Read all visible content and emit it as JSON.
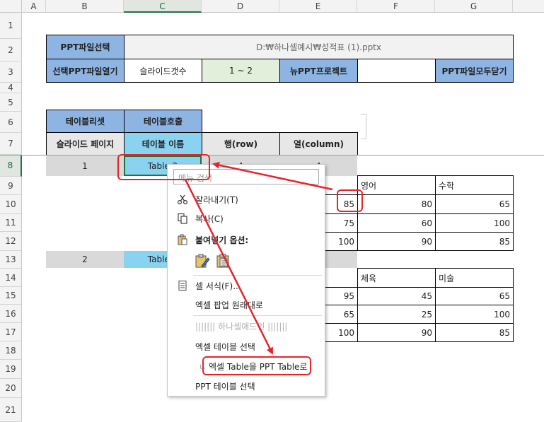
{
  "columns": [
    "A",
    "B",
    "C",
    "D",
    "E",
    "F",
    "G"
  ],
  "rows": [
    "1",
    "2",
    "3",
    "4",
    "5",
    "6",
    "7",
    "8",
    "9",
    "10",
    "11",
    "12",
    "13",
    "14",
    "15",
    "16",
    "17",
    "18",
    "19",
    "20",
    "21"
  ],
  "header_block": {
    "ppt_file_select": "PPT파일선택",
    "file_path": "D:₩하나셀예시₩성적표 (1).pptx",
    "open_selected_ppt": "선택PPT파일열기",
    "slide_count_label": "슬라이드갯수",
    "slide_count_value": "1 ~ 2",
    "new_ppt_project": "뉴PPT프로젝트",
    "close_all_ppt": "PPT파일모두닫기"
  },
  "table_block": {
    "table_reset": "테이블리셋",
    "table_call": "테이블호출",
    "slide_page": "슬라이드 페이지",
    "table_name": "테이블 이름",
    "row_header": "행(row)",
    "col_header": "열(column)",
    "row1_slide": "1",
    "row1_table": "Table 2",
    "row1_rows": "4",
    "row1_cols": "4",
    "row2_slide": "2",
    "row2_table": "Table 2"
  },
  "grid1": {
    "headers": [
      "영어",
      "수학"
    ],
    "rows": [
      [
        "85",
        "80",
        "65"
      ],
      [
        "75",
        "60",
        "100"
      ],
      [
        "100",
        "90",
        "85"
      ]
    ]
  },
  "grid2": {
    "headers": [
      "체육",
      "미술"
    ],
    "rows": [
      [
        "95",
        "45",
        "65"
      ],
      [
        "65",
        "25",
        "100"
      ],
      [
        "100",
        "90",
        "85"
      ]
    ]
  },
  "context_menu": {
    "search_placeholder": "메뉴 검색",
    "cut": "잘라내기(T)",
    "copy": "복사(C)",
    "paste_options": "붙여넣기 옵션:",
    "format_cells": "셀 서식(F)...",
    "excel_popup_restore": "엑셀 팝업 원래대로",
    "hanacell_addin": "||||||| 하나셀애드인 |||||||",
    "excel_table_select": "엑셀 테이블 선택",
    "excel_to_ppt_table": "엑셀 Table을 PPT Table로",
    "ppt_table_select": "PPT 테이블 선택"
  },
  "colors": {
    "annotation_red": "#e8232a",
    "header_blue": "#8db4e2",
    "cyan": "#8ad3f0",
    "green": "#e2efda"
  }
}
